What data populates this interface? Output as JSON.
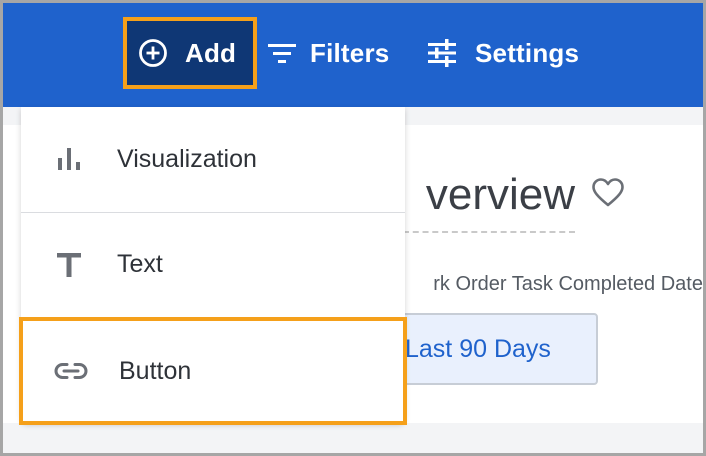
{
  "toolbar": {
    "add_label": "Add",
    "filters_label": "Filters",
    "settings_label": "Settings"
  },
  "dashboard": {
    "title": "verview",
    "filter_label": "rk Order Task Completed Date",
    "filter_value": "Last 90 Days"
  },
  "menu": {
    "items": [
      {
        "label": "Visualization",
        "icon": "bar-chart-icon"
      },
      {
        "label": "Text",
        "icon": "text-t-icon"
      },
      {
        "label": "Button",
        "icon": "link-icon"
      }
    ]
  },
  "colors": {
    "toolbar_bg": "#1f62cc",
    "add_bg": "#0f3775",
    "highlight": "#f5a01a",
    "chip_text": "#1f62cc"
  }
}
